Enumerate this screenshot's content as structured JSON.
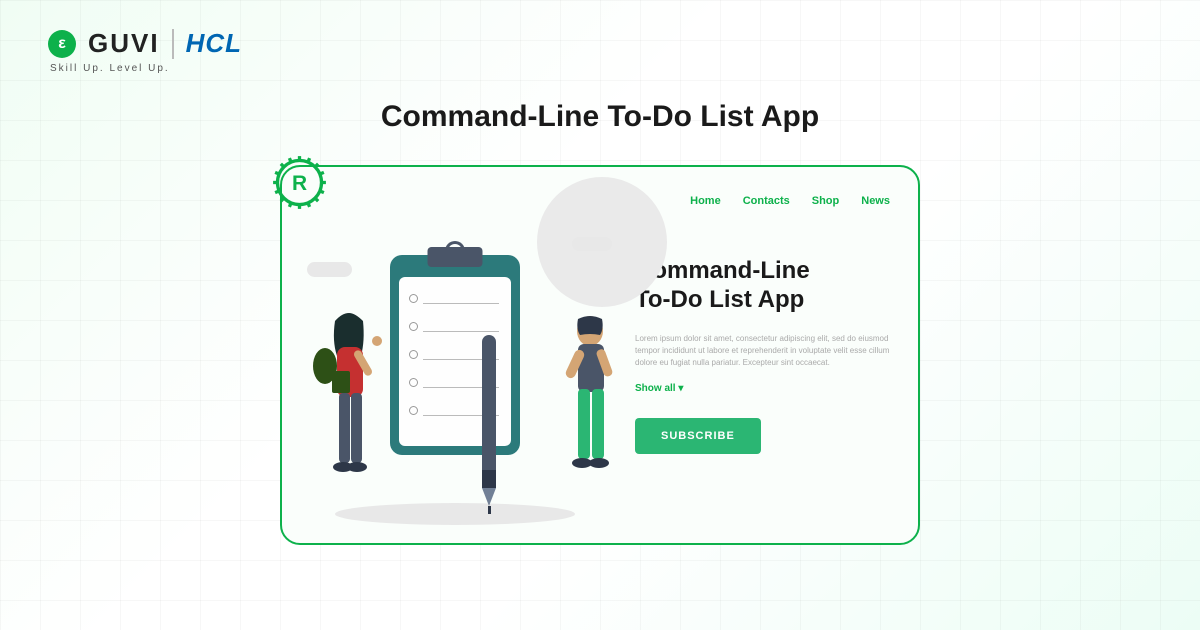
{
  "logo": {
    "guvi_symbol": "ε",
    "guvi_text": "GUVI",
    "hcl_text": "HCL",
    "tagline": "Skill Up. Level Up."
  },
  "main_title": "Command-Line To-Do List App",
  "card": {
    "nav": [
      {
        "label": "Home"
      },
      {
        "label": "Contacts"
      },
      {
        "label": "Shop"
      },
      {
        "label": "News"
      }
    ],
    "heading_line1": "Command-Line",
    "heading_line2": "To-Do List App",
    "description": "Lorem ipsum dolor sit amet, consectetur adipiscing elit, sed do eiusmod tempor incididunt ut labore et reprehenderit in voluptate velit esse cillum dolore eu fugiat nulla pariatur. Excepteur sint occaecat.",
    "show_all": "Show all ▾",
    "subscribe": "SUBSCRIBE"
  },
  "colors": {
    "brand_green": "#0db14b",
    "hcl_blue": "#0066b3",
    "btn_green": "#2bb673"
  }
}
